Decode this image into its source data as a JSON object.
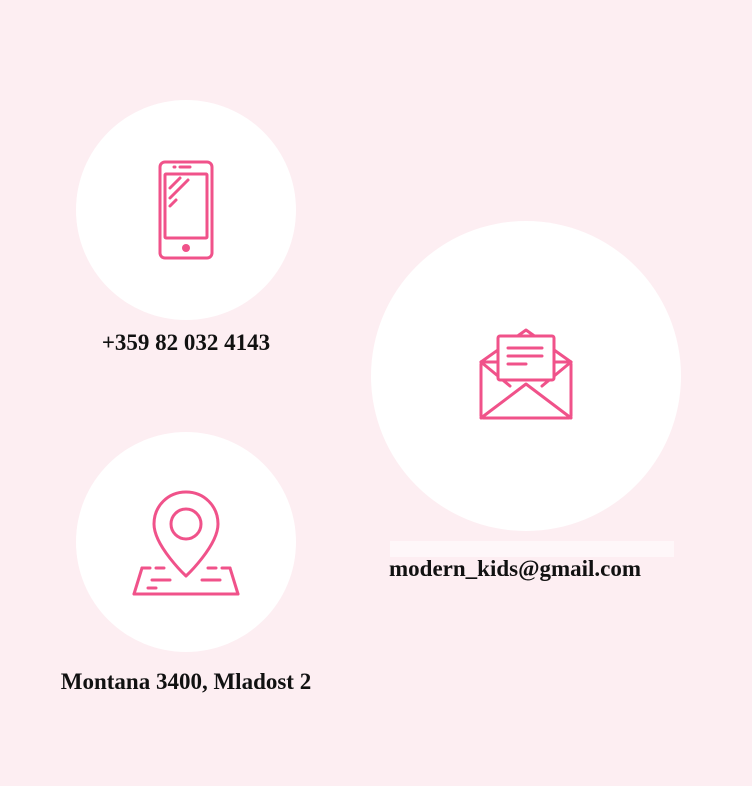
{
  "colors": {
    "background": "#fdeef2",
    "circle": "#ffffff",
    "icon_accent": "#f0528a",
    "text": "#111111"
  },
  "contacts": {
    "phone": {
      "icon": "smartphone-icon",
      "text": "+359 82 032 4143"
    },
    "email": {
      "icon": "open-envelope-icon",
      "text": "modern_kids@gmail.com"
    },
    "location": {
      "icon": "map-pin-icon",
      "text": "Montana 3400, Mladost 2"
    }
  }
}
